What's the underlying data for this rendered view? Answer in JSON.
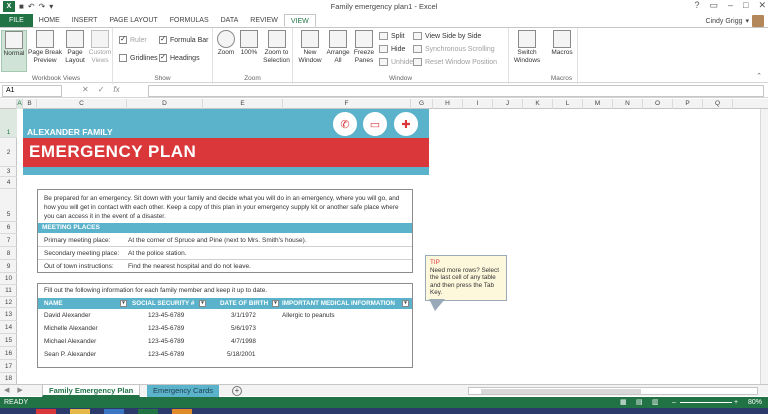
{
  "window": {
    "title": "Family emergency plan1 - Excel",
    "user": "Cindy Grigg"
  },
  "qat": {
    "undo": "↶",
    "redo": "↷",
    "customize": "▾"
  },
  "tabs": [
    "FILE",
    "HOME",
    "INSERT",
    "PAGE LAYOUT",
    "FORMULAS",
    "DATA",
    "REVIEW",
    "VIEW"
  ],
  "active_tab": "VIEW",
  "ribbon": {
    "workbook_views": {
      "label": "Workbook Views",
      "normal": "Normal",
      "page_break": "Page Break Preview",
      "page_layout": "Page Layout",
      "custom_views": "Custom Views"
    },
    "show": {
      "label": "Show",
      "ruler": "Ruler",
      "formula_bar": "Formula Bar",
      "gridlines": "Gridlines",
      "headings": "Headings"
    },
    "zoom": {
      "label": "Zoom",
      "zoom": "Zoom",
      "hundred": "100%",
      "zoom_selection": "Zoom to Selection"
    },
    "window": {
      "label": "Window",
      "new_window": "New Window",
      "arrange_all": "Arrange All",
      "freeze_panes": "Freeze Panes",
      "split": "Split",
      "hide": "Hide",
      "unhide": "Unhide",
      "side_by_side": "View Side by Side",
      "sync_scroll": "Synchronous Scrolling",
      "reset_pos": "Reset Window Position",
      "switch_windows": "Switch Windows"
    },
    "macros": {
      "label": "Macros",
      "macros": "Macros"
    }
  },
  "formula_bar": {
    "name_box": "A1",
    "fx": "fx",
    "cancel": "✕",
    "enter": "✓"
  },
  "columns": [
    "A",
    "B",
    "C",
    "D",
    "E",
    "F",
    "G",
    "H",
    "I",
    "J",
    "K",
    "L",
    "M",
    "N",
    "O",
    "P",
    "Q"
  ],
  "rows": [
    "1",
    "2",
    "3",
    "4",
    "5",
    "6",
    "7",
    "8",
    "9",
    "10",
    "11",
    "12",
    "13",
    "14",
    "15",
    "16",
    "17",
    "18"
  ],
  "sheet": {
    "family": "ALEXANDER FAMILY",
    "title": "EMERGENCY PLAN",
    "intro": "Be prepared for an emergency. Sit down with your family and decide what you will do in an emergency, where you will go, and how you will get in contact with each other. Keep a copy of this plan in your emergency supply kit or another safe place where you can access it in the event of a disaster.",
    "meeting_header": "MEETING PLACES",
    "meeting": [
      {
        "k": "Primary meeting place:",
        "v": "At the corner of Spruce and Pine (next to Mrs. Smith's house)."
      },
      {
        "k": "Secondary meeting place:",
        "v": "At the police station."
      },
      {
        "k": "Out of town instructions:",
        "v": "Find the nearest hospital and do not leave."
      }
    ],
    "fill_note": "Fill out the following information for each family member and keep it up to date.",
    "table_headers": [
      "NAME",
      "SOCIAL SECURITY #",
      "DATE OF BIRTH",
      "IMPORTANT MEDICAL INFORMATION"
    ],
    "members": [
      {
        "name": "David Alexander",
        "ssn": "123-45-6789",
        "dob": "3/1/1972",
        "med": "Allergic to peanuts"
      },
      {
        "name": "Michelle Alexander",
        "ssn": "123-45-6789",
        "dob": "5/6/1973",
        "med": ""
      },
      {
        "name": "Michael Alexander",
        "ssn": "123-45-6789",
        "dob": "4/7/1998",
        "med": ""
      },
      {
        "name": "Sean P. Alexander",
        "ssn": "123-45-6789",
        "dob": "5/18/2001",
        "med": ""
      }
    ],
    "tip_title": "TIP",
    "tip_text": "Need more rows? Select the last cell of any table and then press the Tab Key."
  },
  "sheet_tabs": {
    "active": "Family Emergency Plan",
    "inactive": "Emergency Cards",
    "add": "+"
  },
  "status": {
    "ready": "READY",
    "zoom": "80%"
  },
  "colors": {
    "teal": "#5bb3cb",
    "red": "#d9373a",
    "excel_green": "#217346"
  }
}
